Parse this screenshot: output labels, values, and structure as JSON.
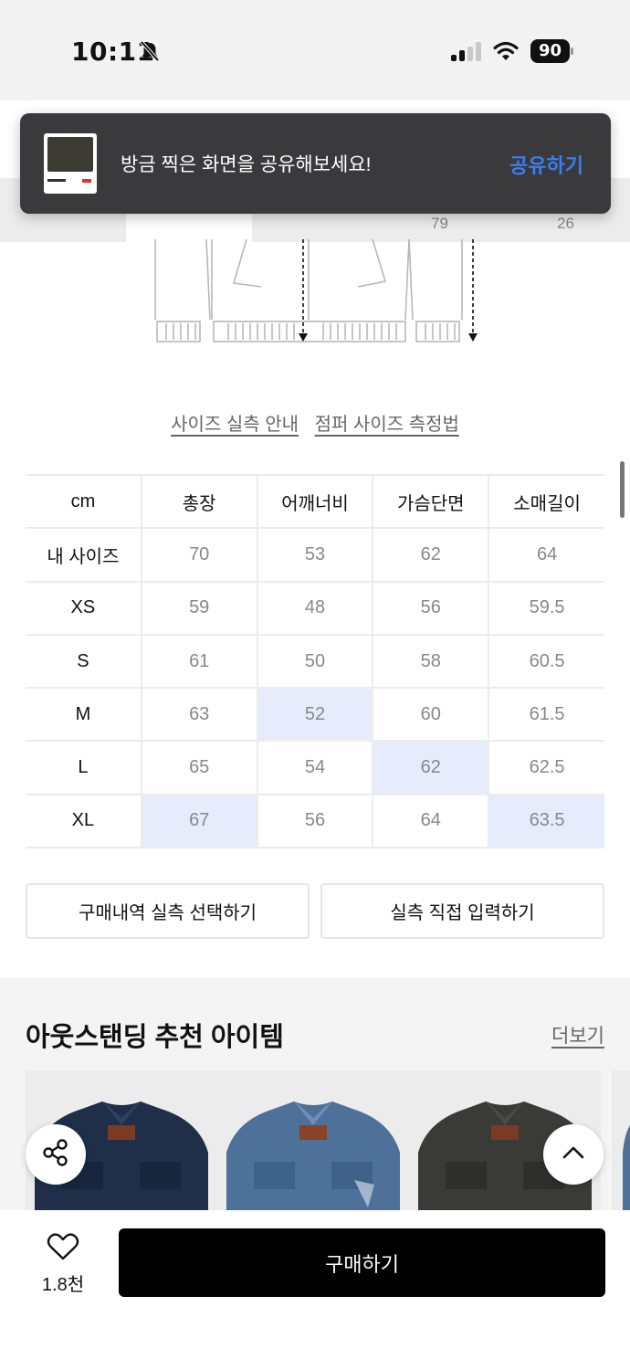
{
  "status": {
    "time": "10:11",
    "battery": "90"
  },
  "toast": {
    "message": "방금 찍은 화면을 공유해보세요!",
    "action": "공유하기"
  },
  "tab_strip": {
    "partial_values": [
      "79",
      "26"
    ]
  },
  "guide": {
    "link_measure": "사이즈 실측 안내",
    "link_method": "점퍼 사이즈 측정법"
  },
  "size_table": {
    "headers": [
      "cm",
      "총장",
      "어깨너비",
      "가슴단면",
      "소매길이"
    ],
    "rows": [
      {
        "label": "내 사이즈",
        "values": [
          "70",
          "53",
          "62",
          "64"
        ]
      },
      {
        "label": "XS",
        "values": [
          "59",
          "48",
          "56",
          "59.5"
        ]
      },
      {
        "label": "S",
        "values": [
          "61",
          "50",
          "58",
          "60.5"
        ]
      },
      {
        "label": "M",
        "values": [
          "63",
          "52",
          "60",
          "61.5"
        ]
      },
      {
        "label": "L",
        "values": [
          "65",
          "54",
          "62",
          "62.5"
        ]
      },
      {
        "label": "XL",
        "values": [
          "67",
          "56",
          "64",
          "63.5"
        ]
      }
    ],
    "highlight_color": "#e6ecfb"
  },
  "actions": {
    "purchase_history": "구매내역 실측 선택하기",
    "manual_input": "실측 직접 입력하기"
  },
  "recommend": {
    "title": "아웃스탠딩 추천 아이템",
    "more": "더보기"
  },
  "bottom": {
    "likes": "1.8천",
    "buy": "구매하기"
  },
  "colors": {
    "accent_link": "#3c7cf2",
    "toast_bg": "#3a3a3c",
    "buy_bg": "#000000"
  },
  "icons": [
    "bell-slash-icon",
    "signal-icon",
    "wifi-icon",
    "battery-icon",
    "share-icon",
    "chevron-up-icon",
    "heart-icon"
  ]
}
